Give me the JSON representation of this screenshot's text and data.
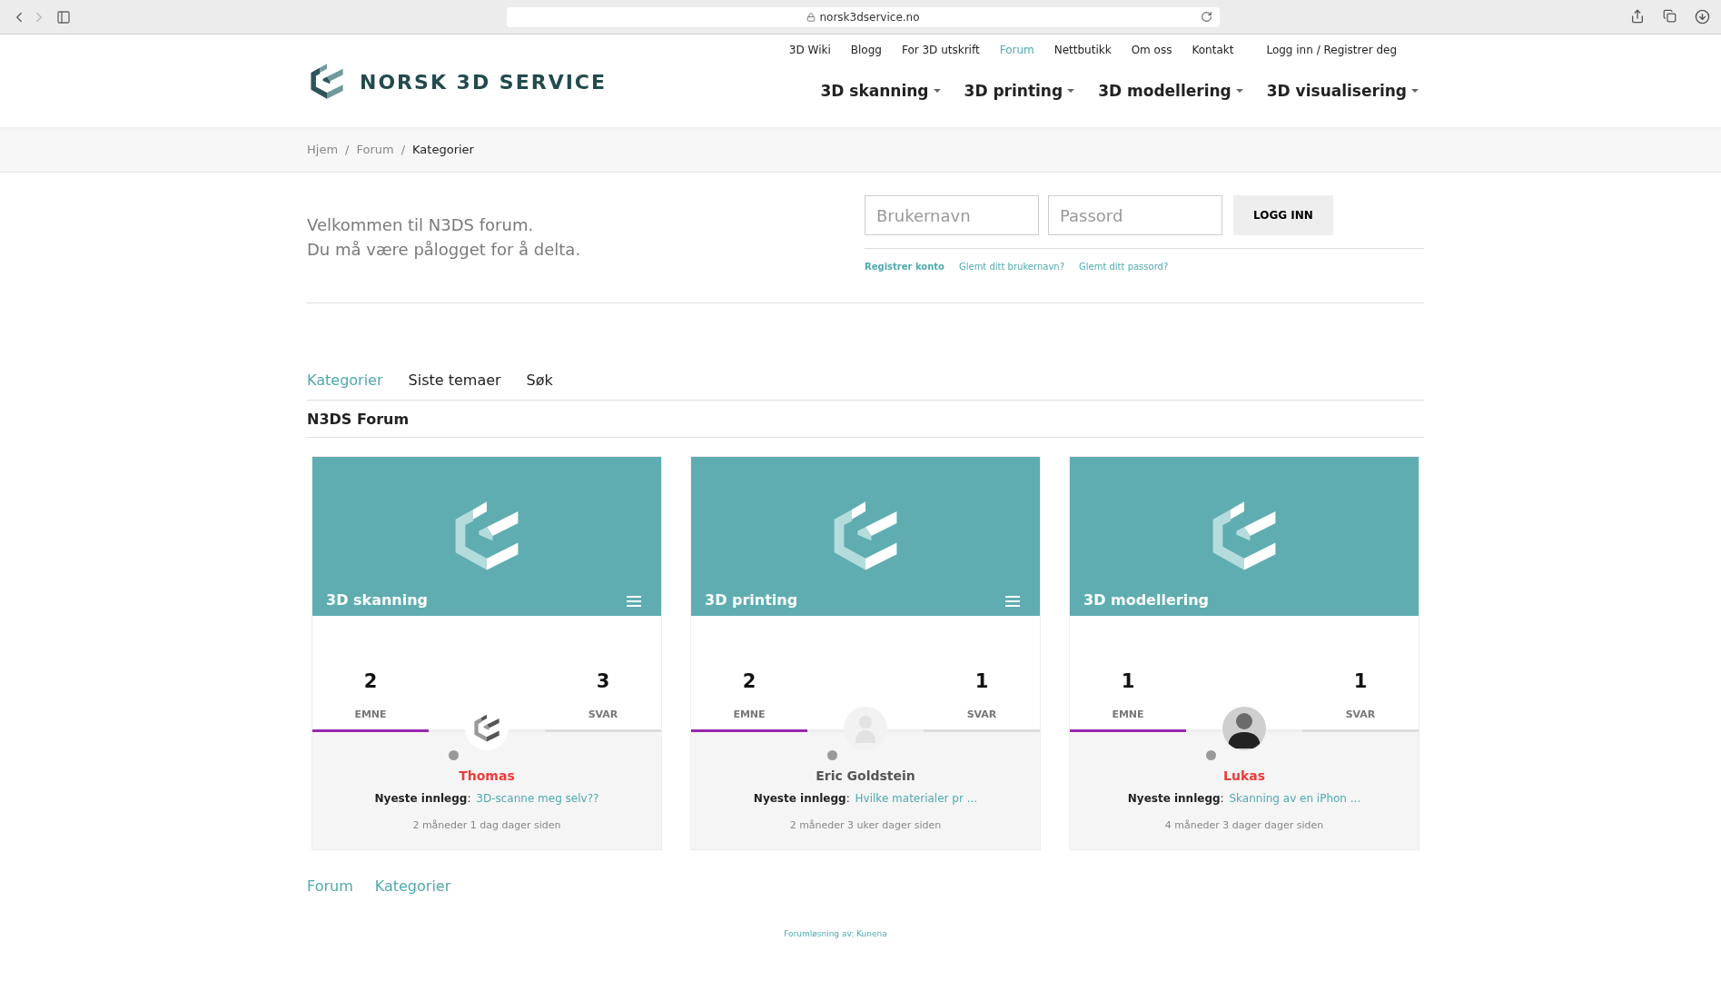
{
  "browser": {
    "url": "norsk3dservice.no"
  },
  "brand": {
    "name": "NORSK 3D SERVICE"
  },
  "top_nav": [
    {
      "label": "3D Wiki",
      "selected": false
    },
    {
      "label": "Blogg",
      "selected": false
    },
    {
      "label": "For 3D utskrift",
      "selected": false
    },
    {
      "label": "Forum",
      "selected": true
    },
    {
      "label": "Nettbutikk",
      "selected": false
    },
    {
      "label": "Om oss",
      "selected": false
    },
    {
      "label": "Kontakt",
      "selected": false
    },
    {
      "label": "Logg inn / Registrer deg",
      "selected": false
    }
  ],
  "main_nav": [
    {
      "label": "3D skanning"
    },
    {
      "label": "3D printing"
    },
    {
      "label": "3D modellering"
    },
    {
      "label": "3D visualisering"
    }
  ],
  "breadcrumb_separator": "/",
  "breadcrumb": [
    {
      "label": "Hjem",
      "current": false
    },
    {
      "label": "Forum",
      "current": false
    },
    {
      "label": "Kategorier",
      "current": true
    }
  ],
  "welcome": [
    "Velkommen til N3DS forum.",
    "Du må være pålogget for å delta."
  ],
  "login": {
    "username_placeholder": "Brukernavn",
    "password_placeholder": "Passord",
    "button": "LOGG INN",
    "links": [
      {
        "label": "Registrer konto",
        "bold": true
      },
      {
        "label": "Glemt ditt brukernavn?",
        "bold": false
      },
      {
        "label": "Glemt ditt passord?",
        "bold": false
      }
    ]
  },
  "tabs": [
    {
      "label": "Kategorier",
      "selected": true
    },
    {
      "label": "Siste temaer",
      "selected": false
    },
    {
      "label": "Søk",
      "selected": false
    }
  ],
  "section_title": "N3DS Forum",
  "categories": [
    {
      "title": "3D skanning",
      "menu": true,
      "topics": "2",
      "topics_label": "EMNE",
      "replies": "3",
      "replies_label": "SVAR",
      "avatar": {
        "kind": "logo"
      },
      "user": {
        "name": "Thomas",
        "color": "#f03a3a"
      },
      "latest_label": "**Nyeste innlegg**:",
      "latest_link": "3D-scanne meg selv??",
      "time": "2 måneder 1 dag dager siden"
    },
    {
      "title": "3D printing",
      "menu": true,
      "topics": "2",
      "topics_label": "EMNE",
      "replies": "1",
      "replies_label": "SVAR",
      "avatar": {
        "kind": "default"
      },
      "user": {
        "name": "Eric Goldstein",
        "color": "#555555"
      },
      "latest_label": "**Nyeste innlegg**:",
      "latest_link": "Hvilke materialer pr ...",
      "time": "2 måneder 3 uker dager siden"
    },
    {
      "title": "3D modellering",
      "menu": false,
      "topics": "1",
      "topics_label": "EMNE",
      "replies": "1",
      "replies_label": "SVAR",
      "avatar": {
        "kind": "photo"
      },
      "user": {
        "name": "Lukas",
        "color": "#f03a3a"
      },
      "latest_label": "**Nyeste innlegg**:",
      "latest_link": "Skanning av en iPhon ...",
      "time": "4 måneder 3 dager dager siden"
    }
  ],
  "footer_links": [
    "Forum",
    "Kategorier"
  ],
  "credit": "Forumløsning av: Kunena"
}
